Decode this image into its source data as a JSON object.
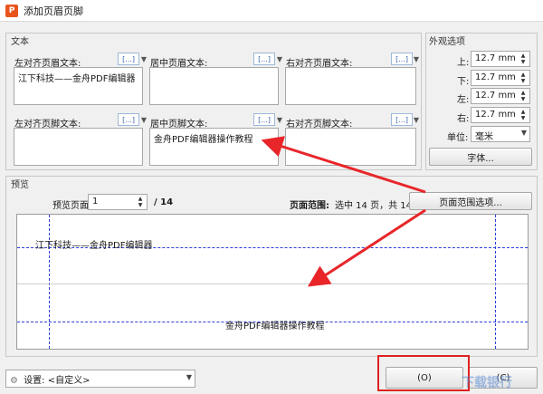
{
  "window": {
    "title": "添加页眉页脚",
    "app_icon": "P"
  },
  "text_group": {
    "label": "文本",
    "header_left_label": "左对齐页眉文本:",
    "header_center_label": "居中页眉文本:",
    "header_right_label": "右对齐页眉文本:",
    "footer_left_label": "左对齐页脚文本:",
    "footer_center_label": "居中页脚文本:",
    "footer_right_label": "右对齐页脚文本:",
    "header_left_value": "江下科技——金舟PDF编辑器",
    "footer_center_value": "金舟PDF编辑器操作教程",
    "macro_icon": "[...]",
    "macro_arrow": "▼"
  },
  "appearance": {
    "label": "外观选项",
    "top_label": "上:",
    "top_value": "12.7 mm",
    "bottom_label": "下:",
    "bottom_value": "12.7 mm",
    "left_label": "左:",
    "left_value": "12.7 mm",
    "right_label": "右:",
    "right_value": "12.7 mm",
    "unit_label": "单位:",
    "unit_value": "毫米",
    "font_button": "字体..."
  },
  "preview": {
    "label": "预览",
    "page_label": "预览页面",
    "page_value": "1",
    "page_total": "/ 14",
    "range_label": "页面范围:",
    "range_value": "选中 14 页，共 14 页",
    "range_button": "页面范围选项...",
    "header_text": "江下科技——金舟PDF编辑器",
    "footer_text": "金舟PDF编辑器操作教程"
  },
  "bottom": {
    "settings_label": "设置:",
    "settings_value": "<自定义>",
    "ok_button": "(O)",
    "cancel_button": "(C)",
    "watermark": "下载银行"
  },
  "colors": {
    "arrow": "#e8262a",
    "guide": "#2b3fd8",
    "highlight_box": "#e02020",
    "app_icon": "#e8561e"
  }
}
